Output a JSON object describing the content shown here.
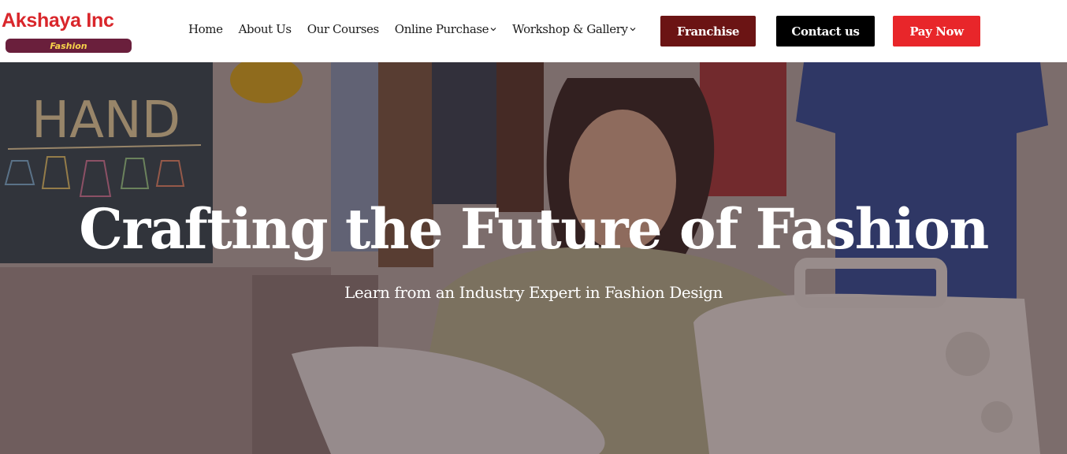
{
  "brand": {
    "name": "Akshaya Inc",
    "tag": "Fashion",
    "colors": {
      "name": "#d9262b",
      "tag_bg": "#6a1f3c",
      "tag_text": "#f7d34a"
    }
  },
  "nav": {
    "items": [
      {
        "label": "Home",
        "has_dropdown": false
      },
      {
        "label": "About Us",
        "has_dropdown": false
      },
      {
        "label": "Our Courses",
        "has_dropdown": false
      },
      {
        "label": "Online Purchase",
        "has_dropdown": true
      },
      {
        "label": "Workshop & Gallery",
        "has_dropdown": true
      }
    ]
  },
  "actions": {
    "franchise": {
      "label": "Franchise",
      "color": "#6b1414"
    },
    "contact": {
      "label": "Contact us",
      "color": "#000000"
    },
    "pay": {
      "label": "Pay Now",
      "color": "#e8262a"
    }
  },
  "hero": {
    "title": "Crafting the Future of Fashion",
    "subtitle": "Learn from an Industry Expert in Fashion Design",
    "chalkboard_text": "HAND"
  }
}
